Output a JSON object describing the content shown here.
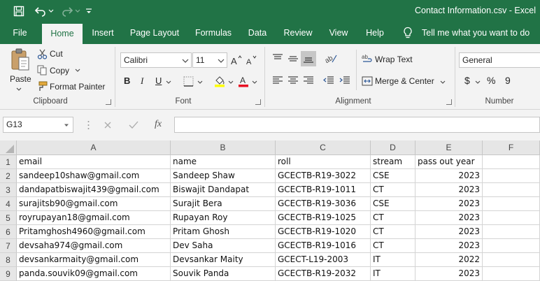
{
  "window": {
    "title": "Contact Information.csv  -  Excel"
  },
  "tabs": [
    "File",
    "Home",
    "Insert",
    "Page Layout",
    "Formulas",
    "Data",
    "Review",
    "View",
    "Help"
  ],
  "tell_me": "Tell me what you want to do",
  "ribbon": {
    "clipboard": {
      "paste": "Paste",
      "cut": "Cut",
      "copy": "Copy",
      "format_painter": "Format Painter",
      "label": "Clipboard"
    },
    "font": {
      "family": "Calibri",
      "size": "11",
      "bold": "B",
      "italic": "I",
      "underline": "U",
      "label": "Font"
    },
    "alignment": {
      "wrap_text": "Wrap Text",
      "merge_center": "Merge & Center",
      "label": "Alignment"
    },
    "number": {
      "format": "General",
      "currency": "$",
      "percent": "%",
      "comma": "9",
      "label": "Number"
    }
  },
  "formula_bar": {
    "name_box": "G13",
    "fx": "fx",
    "formula": ""
  },
  "sheet": {
    "columns": [
      "A",
      "B",
      "C",
      "D",
      "E",
      "F"
    ],
    "row_numbers": [
      "1",
      "2",
      "3",
      "4",
      "5",
      "6",
      "7",
      "8",
      "9"
    ],
    "rows": [
      [
        "email",
        "name",
        "roll",
        "stream",
        "pass out year",
        ""
      ],
      [
        "sandeep10shaw@gmail.com",
        "Sandeep Shaw",
        "GCECTB-R19-3022",
        "CSE",
        "2023",
        ""
      ],
      [
        "dandapatbiswajit439@gmail.com",
        "Biswajit Dandapat",
        "GCECTB-R19-1011",
        "CT",
        "2023",
        ""
      ],
      [
        "surajitsb90@gmail.com",
        "Surajit Bera",
        "GCECTB-R19-3036",
        "CSE",
        "2023",
        ""
      ],
      [
        "royrupayan18@gmail.com",
        "Rupayan Roy",
        "GCECTB-R19-1025",
        "CT",
        "2023",
        ""
      ],
      [
        "Pritamghosh4960@gmail.com",
        "Pritam Ghosh",
        "GCECTB-R19-1020",
        "CT",
        "2023",
        ""
      ],
      [
        "devsaha974@gmail.com",
        "Dev Saha",
        "GCECTB-R19-1016",
        "CT",
        "2023",
        ""
      ],
      [
        "devsankarmaity@gmail.com",
        "Devsankar Maity",
        "GCECT-L19-2003",
        "IT",
        "2022",
        ""
      ],
      [
        "panda.souvik09@gmail.com",
        "Souvik Panda",
        "GCECTB-R19-2032",
        "IT",
        "2023",
        ""
      ]
    ]
  }
}
